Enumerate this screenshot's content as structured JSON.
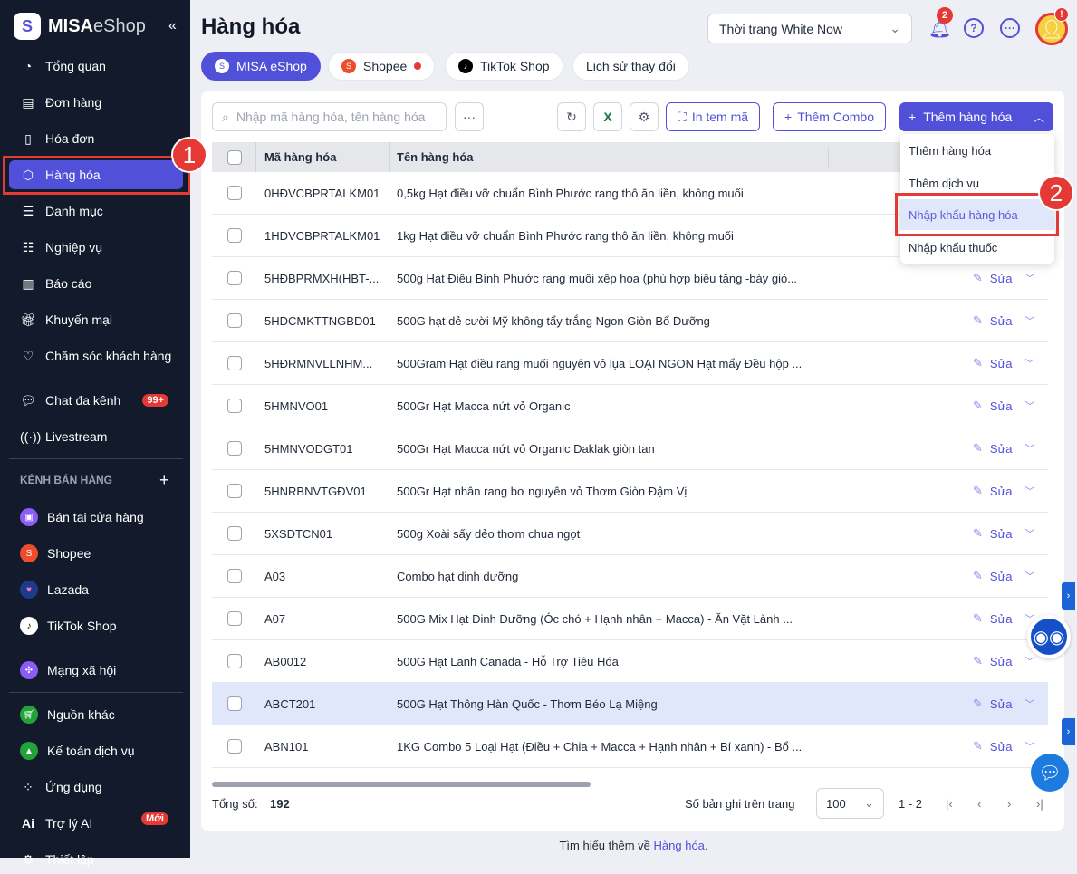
{
  "sidebar": {
    "logo_brand": "MISA",
    "logo_product": "eShop",
    "collapse": "«",
    "items": [
      {
        "label": "Tổng quan",
        "icon": "gauge-icon"
      },
      {
        "label": "Đơn hàng",
        "icon": "order-icon"
      },
      {
        "label": "Hóa đơn",
        "icon": "invoice-icon"
      },
      {
        "label": "Hàng hóa",
        "icon": "box-icon"
      },
      {
        "label": "Danh mục",
        "icon": "list-icon"
      },
      {
        "label": "Nghiệp vụ",
        "icon": "tasks-icon"
      },
      {
        "label": "Báo cáo",
        "icon": "chart-icon"
      },
      {
        "label": "Khuyến mại",
        "icon": "gift-icon"
      },
      {
        "label": "Chăm sóc khách hàng",
        "icon": "heart-icon"
      }
    ],
    "chat": {
      "label": "Chat đa kênh",
      "badge": "99+"
    },
    "livestream": "Livestream",
    "section_title": "KÊNH BÁN HÀNG",
    "section_add": "+",
    "channels": [
      {
        "label": "Bán tại cửa hàng",
        "color": "#8B5CF6"
      },
      {
        "label": "Shopee",
        "color": "#EE4D2D"
      },
      {
        "label": "Lazada",
        "color": "#1E3A8A"
      },
      {
        "label": "TikTok Shop",
        "color": "#ffffff"
      }
    ],
    "social": "Mạng xã hội",
    "other": "Nguồn khác",
    "accounting": "Kế toán dịch vụ",
    "apps": "Ứng dụng",
    "ai": {
      "label": "Trợ lý AI",
      "badge": "Mới",
      "icon_text": "Ai"
    },
    "settings": "Thiết lập"
  },
  "header": {
    "title": "Hàng hóa",
    "store": "Thời trang White Now",
    "notif_count": "2",
    "avatar_alert": "!"
  },
  "tabs": [
    {
      "label": "MISA eShop"
    },
    {
      "label": "Shopee"
    },
    {
      "label": "TikTok Shop"
    },
    {
      "label": "Lịch sử thay đổi"
    }
  ],
  "toolbar": {
    "search_placeholder": "Nhập mã hàng hóa, tên hàng hóa",
    "more": "···",
    "print": "In tem mã",
    "combo": "Thêm Combo",
    "add": "Thêm hàng hóa"
  },
  "dropdown": [
    "Thêm hàng hóa",
    "Thêm dịch vụ",
    "Nhập khẩu hàng hóa",
    "Nhập khẩu thuốc"
  ],
  "table": {
    "headers": [
      "Mã hàng hóa",
      "Tên hàng hóa"
    ],
    "edit_label": "Sửa",
    "rows": [
      [
        "0HĐVCBPRTALKM01",
        "0,5kg Hạt điều vỡ chuẩn Bình Phước rang thô ăn liền, không muối"
      ],
      [
        "1HDVCBPRTALKM01",
        "1kg Hạt điều vỡ chuẩn Bình Phước rang thô ăn liền, không muối"
      ],
      [
        "5HĐBPRMXH(HBT-...",
        "500g Hạt Điều Bình Phước rang muối xếp hoa (phù hợp biếu tặng -bày giỏ..."
      ],
      [
        "5HDCMKTTNGBD01",
        "500G hạt dẻ cười Mỹ không tẩy trắng Ngon Giòn Bổ Dưỡng"
      ],
      [
        "5HĐRMNVLLNHM...",
        "500Gram Hạt điều rang muối nguyên vỏ lụa LOẠI NGON Hạt mẩy Đều hộp ..."
      ],
      [
        "5HMNVO01",
        "500Gr Hạt Macca nứt vỏ Organic"
      ],
      [
        "5HMNVODGT01",
        "500Gr Hạt Macca nứt vỏ Organic Daklak giòn tan"
      ],
      [
        "5HNRBNVTGĐV01",
        "500Gr Hạt nhân rang bơ nguyên vỏ Thơm Giòn Đậm Vị"
      ],
      [
        "5XSDTCN01",
        "500g Xoài sấy dẻo thơm chua ngọt"
      ],
      [
        "A03",
        "Combo hạt dinh dưỡng"
      ],
      [
        "A07",
        "500G Mix Hạt Dinh Dưỡng (Óc chó + Hạnh nhân + Macca) - Ăn Vặt Lành ..."
      ],
      [
        "AB0012",
        "500G Hạt Lanh Canada - Hỗ Trợ Tiêu Hóa"
      ],
      [
        "ABCT201",
        "500G Hạt Thông Hàn Quốc - Thơm Béo Lạ Miệng"
      ],
      [
        "ABN101",
        "1KG Combo 5 Loại Hạt (Điều + Chia + Macca + Hạnh nhân + Bí xanh) - Bổ ..."
      ]
    ]
  },
  "footer": {
    "total_label": "Tổng số:",
    "total": "192",
    "per_page_label": "Số bản ghi trên trang",
    "per_page": "100",
    "range": "1 - 2",
    "learn_more": "Tìm hiểu thêm về",
    "learn_link": "Hàng hóa."
  },
  "annotations": [
    "1",
    "2"
  ],
  "colors": {
    "accent": "#5150D9",
    "sidebar": "#121A2B",
    "annotation": "#E53935"
  }
}
